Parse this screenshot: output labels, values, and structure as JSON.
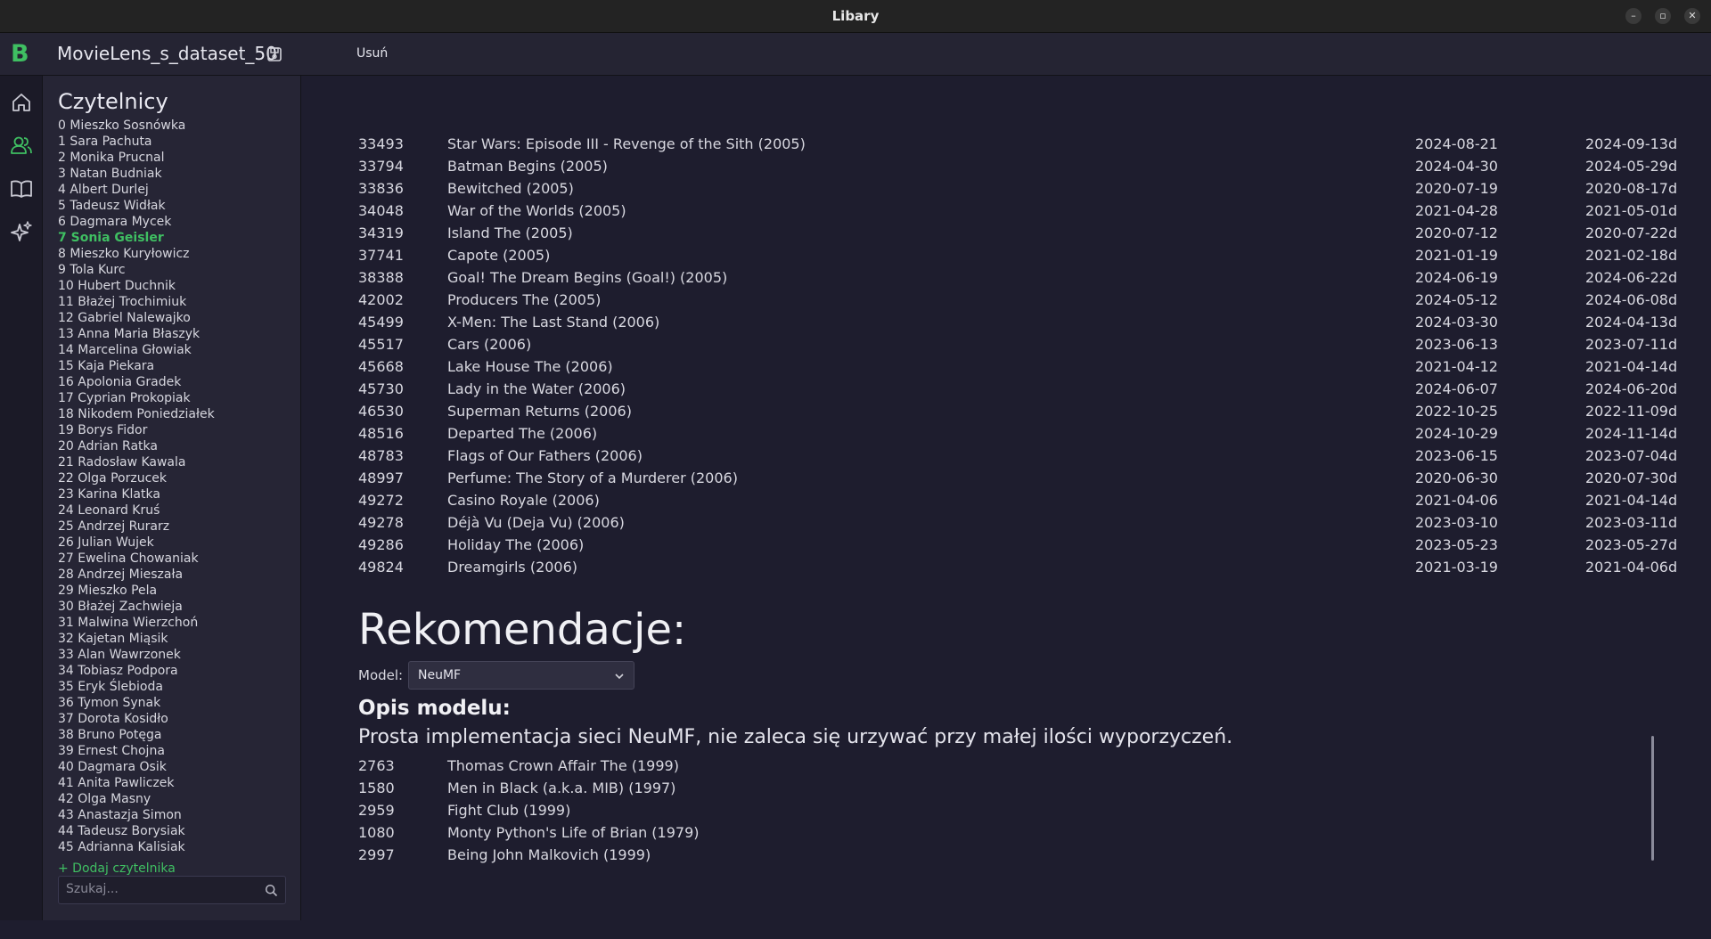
{
  "window": {
    "title": "Libary"
  },
  "appbar": {
    "logo": "B",
    "db_name": "MovieLens_s_dataset_50",
    "delete_label": "Usuń"
  },
  "nav": {
    "icons": [
      "home-icon",
      "users-icon",
      "book-icon",
      "sparkles-icon"
    ],
    "active": "users-icon"
  },
  "sidebar": {
    "title": "Czytelnicy",
    "active_index": 7,
    "readers": [
      "0 Mieszko Sosnówka",
      "1 Sara Pachuta",
      "2 Monika Prucnal",
      "3 Natan Budniak",
      "4 Albert Durlej",
      "5 Tadeusz Widłak",
      "6 Dagmara Mycek",
      "7 Sonia Geisler",
      "8 Mieszko Kuryłowicz",
      "9 Tola Kurc",
      "10 Hubert Duchnik",
      "11 Błażej Trochimiuk",
      "12 Gabriel Nalewajko",
      "13 Anna Maria Błaszyk",
      "14 Marcelina Głowiak",
      "15 Kaja Piekara",
      "16 Apolonia Gradek",
      "17 Cyprian Prokopiak",
      "18 Nikodem Poniedziałek",
      "19 Borys Fidor",
      "20 Adrian Ratka",
      "21 Radosław Kawala",
      "22 Olga Porzucek",
      "23 Karina Klatka",
      "24 Leonard Kruś",
      "25 Andrzej Rurarz",
      "26 Julian Wujek",
      "27 Ewelina Chowaniak",
      "28 Andrzej Mieszała",
      "29 Mieszko Pela",
      "30 Błażej Zachwieja",
      "31 Malwina Wierzchoń",
      "32 Kajetan Miąsik",
      "33 Alan Wawrzonek",
      "34 Tobiasz Podpora",
      "35 Eryk Ślebioda",
      "36 Tymon Synak",
      "37 Dorota Kosidło",
      "38 Bruno Potęga",
      "39 Ernest Chojna",
      "40 Dagmara Osik",
      "41 Anita Pawliczek",
      "42 Olga Masny",
      "43 Anastazja Simon",
      "44 Tadeusz Borysiak",
      "45 Adrianna Kalisiak"
    ],
    "add_label": "+ Dodaj czytelnika",
    "search_placeholder": "Szukaj..."
  },
  "loans": [
    {
      "id": "33493",
      "title": "Star Wars: Episode III - Revenge of the Sith (2005)",
      "start": "2024-08-21",
      "end": "2024-09-13d"
    },
    {
      "id": "33794",
      "title": "Batman Begins (2005)",
      "start": "2024-04-30",
      "end": "2024-05-29d"
    },
    {
      "id": "33836",
      "title": "Bewitched (2005)",
      "start": "2020-07-19",
      "end": "2020-08-17d"
    },
    {
      "id": "34048",
      "title": "War of the Worlds (2005)",
      "start": "2021-04-28",
      "end": "2021-05-01d"
    },
    {
      "id": "34319",
      "title": "Island The (2005)",
      "start": "2020-07-12",
      "end": "2020-07-22d"
    },
    {
      "id": "37741",
      "title": "Capote (2005)",
      "start": "2021-01-19",
      "end": "2021-02-18d"
    },
    {
      "id": "38388",
      "title": "Goal! The Dream Begins (Goal!) (2005)",
      "start": "2024-06-19",
      "end": "2024-06-22d"
    },
    {
      "id": "42002",
      "title": "Producers The (2005)",
      "start": "2024-05-12",
      "end": "2024-06-08d"
    },
    {
      "id": "45499",
      "title": "X-Men: The Last Stand (2006)",
      "start": "2024-03-30",
      "end": "2024-04-13d"
    },
    {
      "id": "45517",
      "title": "Cars (2006)",
      "start": "2023-06-13",
      "end": "2023-07-11d"
    },
    {
      "id": "45668",
      "title": "Lake House The (2006)",
      "start": "2021-04-12",
      "end": "2021-04-14d"
    },
    {
      "id": "45730",
      "title": "Lady in the Water (2006)",
      "start": "2024-06-07",
      "end": "2024-06-20d"
    },
    {
      "id": "46530",
      "title": "Superman Returns (2006)",
      "start": "2022-10-25",
      "end": "2022-11-09d"
    },
    {
      "id": "48516",
      "title": "Departed The (2006)",
      "start": "2024-10-29",
      "end": "2024-11-14d"
    },
    {
      "id": "48783",
      "title": "Flags of Our Fathers (2006)",
      "start": "2023-06-15",
      "end": "2023-07-04d"
    },
    {
      "id": "48997",
      "title": "Perfume: The Story of a Murderer (2006)",
      "start": "2020-06-30",
      "end": "2020-07-30d"
    },
    {
      "id": "49272",
      "title": "Casino Royale (2006)",
      "start": "2021-04-06",
      "end": "2021-04-14d"
    },
    {
      "id": "49278",
      "title": "Déjà Vu (Deja Vu) (2006)",
      "start": "2023-03-10",
      "end": "2023-03-11d"
    },
    {
      "id": "49286",
      "title": "Holiday The (2006)",
      "start": "2023-05-23",
      "end": "2023-05-27d"
    },
    {
      "id": "49824",
      "title": "Dreamgirls (2006)",
      "start": "2021-03-19",
      "end": "2021-04-06d"
    }
  ],
  "recommendations": {
    "heading": "Rekomendacje:",
    "model_label": "Model:",
    "model_value": "NeuMF",
    "desc_heading": "Opis modelu:",
    "desc_text": "Prosta implementacja sieci NeuMF, nie zaleca się urzywać przy małej ilości wyporzyczeń.",
    "items": [
      {
        "id": "2763",
        "title": "Thomas Crown Affair The (1999)"
      },
      {
        "id": "1580",
        "title": "Men in Black (a.k.a. MIB) (1997)"
      },
      {
        "id": "2959",
        "title": "Fight Club (1999)"
      },
      {
        "id": "1080",
        "title": "Monty Python's Life of Brian (1979)"
      },
      {
        "id": "2997",
        "title": "Being John Malkovich (1999)"
      }
    ]
  },
  "colors": {
    "accent": "#3fbf62",
    "background": "#1e1d2e",
    "sidebar": "#262535"
  }
}
